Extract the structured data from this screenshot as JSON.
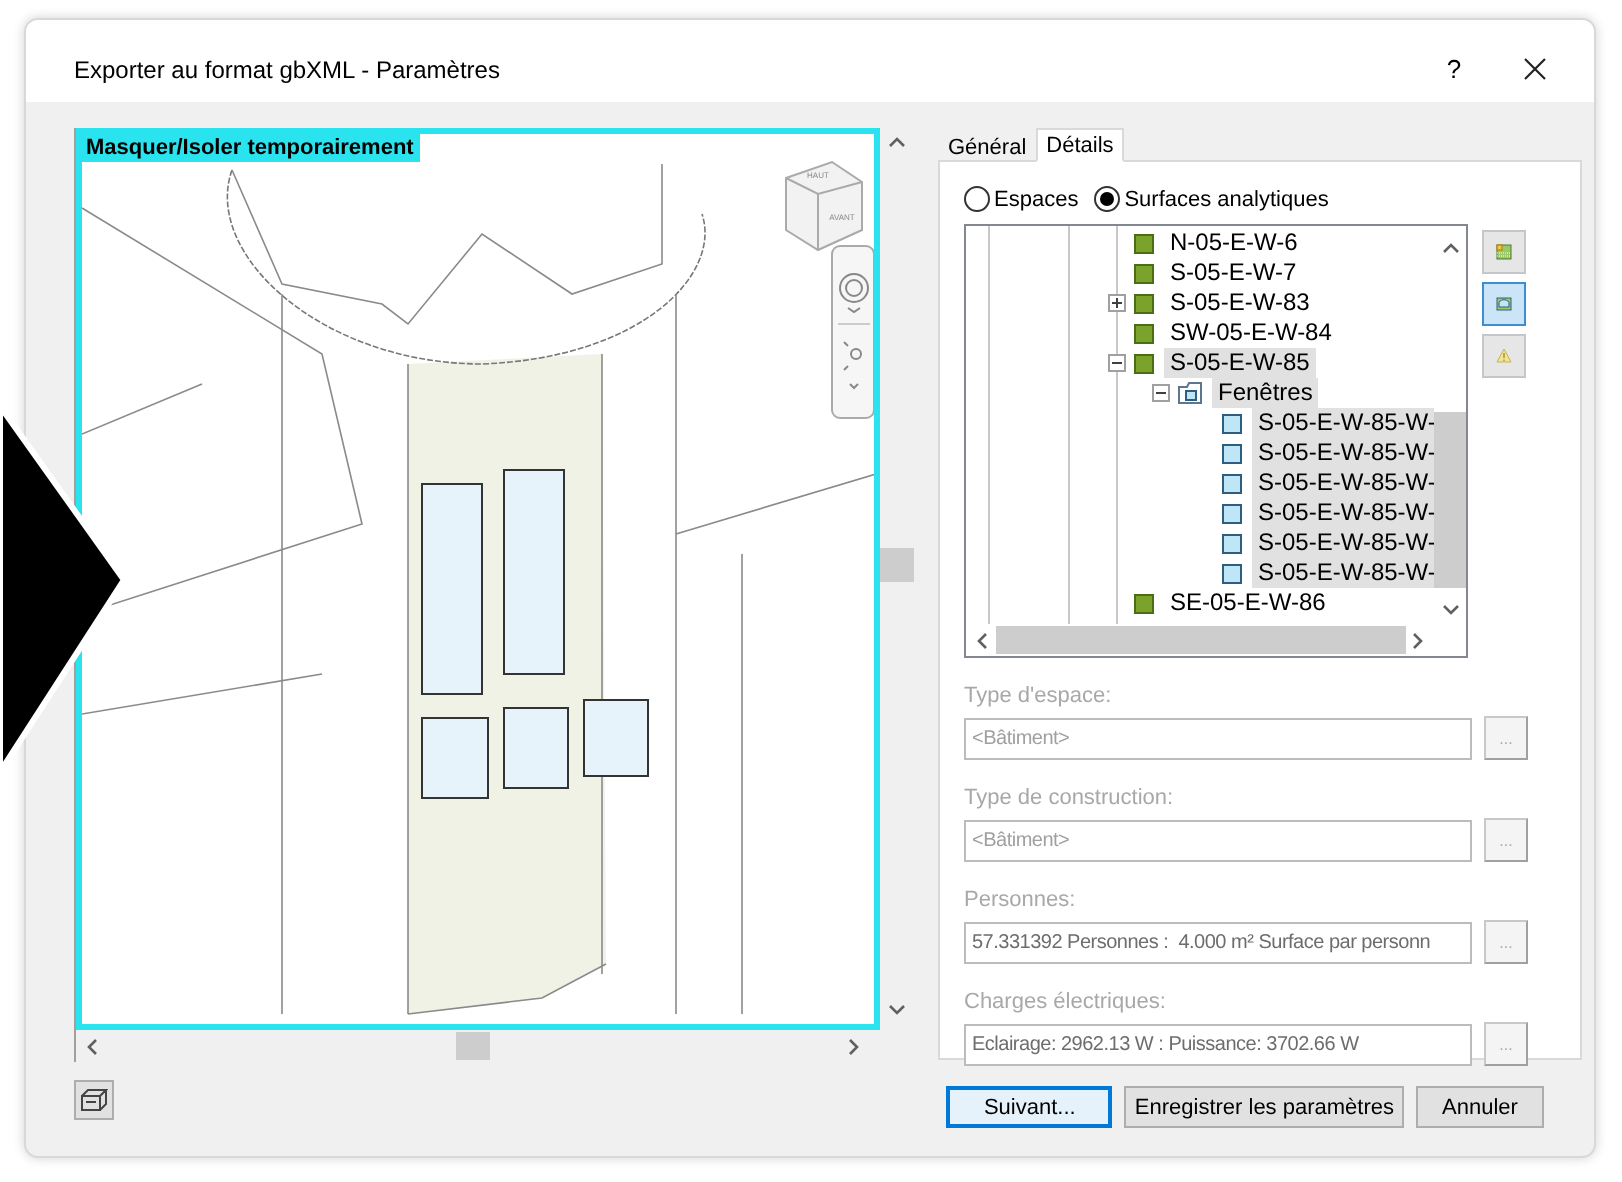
{
  "window": {
    "title": "Exporter au format gbXML - Paramètres",
    "help": "?"
  },
  "viewport": {
    "label": "Masquer/Isoler temporairement",
    "viewcube_top": "HAUT",
    "viewcube_front": "AVANT"
  },
  "tabs": [
    {
      "label": "Général",
      "selected": false
    },
    {
      "label": "Détails",
      "selected": true
    }
  ],
  "mode_options": [
    {
      "label": "Espaces",
      "selected": false
    },
    {
      "label": "Surfaces analytiques",
      "selected": true
    }
  ],
  "tree": [
    {
      "kind": "surface",
      "label": "N-05-E-W-6",
      "selected": false
    },
    {
      "kind": "surface",
      "label": "S-05-E-W-7",
      "selected": false
    },
    {
      "kind": "surface",
      "label": "S-05-E-W-83",
      "selected": false,
      "expanded": false
    },
    {
      "kind": "surface",
      "label": "SW-05-E-W-84",
      "selected": false
    },
    {
      "kind": "surface",
      "label": "S-05-E-W-85",
      "selected": true,
      "expanded": true,
      "children": [
        {
          "kind": "folder",
          "label": "Fenêtres",
          "selected": true,
          "expanded": true,
          "children": [
            {
              "kind": "window",
              "label": "S-05-E-W-85-W-",
              "selected": true
            },
            {
              "kind": "window",
              "label": "S-05-E-W-85-W-",
              "selected": true
            },
            {
              "kind": "window",
              "label": "S-05-E-W-85-W-",
              "selected": true
            },
            {
              "kind": "window",
              "label": "S-05-E-W-85-W-",
              "selected": true
            },
            {
              "kind": "window",
              "label": "S-05-E-W-85-W-",
              "selected": true
            },
            {
              "kind": "window",
              "label": "S-05-E-W-85-W-",
              "selected": true
            }
          ]
        }
      ]
    },
    {
      "kind": "surface",
      "label": "SE-05-E-W-86",
      "selected": false
    }
  ],
  "side_tools": [
    {
      "kind": "grid",
      "selected": false
    },
    {
      "kind": "view",
      "selected": true
    },
    {
      "kind": "warning",
      "selected": false
    }
  ],
  "fields": [
    {
      "label": "Type d'espace:",
      "value": "<Bâtiment>",
      "button": "...",
      "disabled": true
    },
    {
      "label": "Type de construction:",
      "value": "<Bâtiment>",
      "button": "...",
      "disabled": true
    },
    {
      "label": "Personnes:",
      "value": "57.331392 Personnes :  4.000 m² Surface par personn",
      "button": "...",
      "disabled": false
    },
    {
      "label": "Charges électriques:",
      "value": "Eclairage: 2962.13 W : Puissance: 3702.66 W",
      "button": "...",
      "disabled": false
    }
  ],
  "buttons": [
    {
      "label": "Suivant...",
      "focused": true
    },
    {
      "label": "Enregistrer les paramètres",
      "focused": false
    },
    {
      "label": "Annuler",
      "focused": false
    }
  ]
}
